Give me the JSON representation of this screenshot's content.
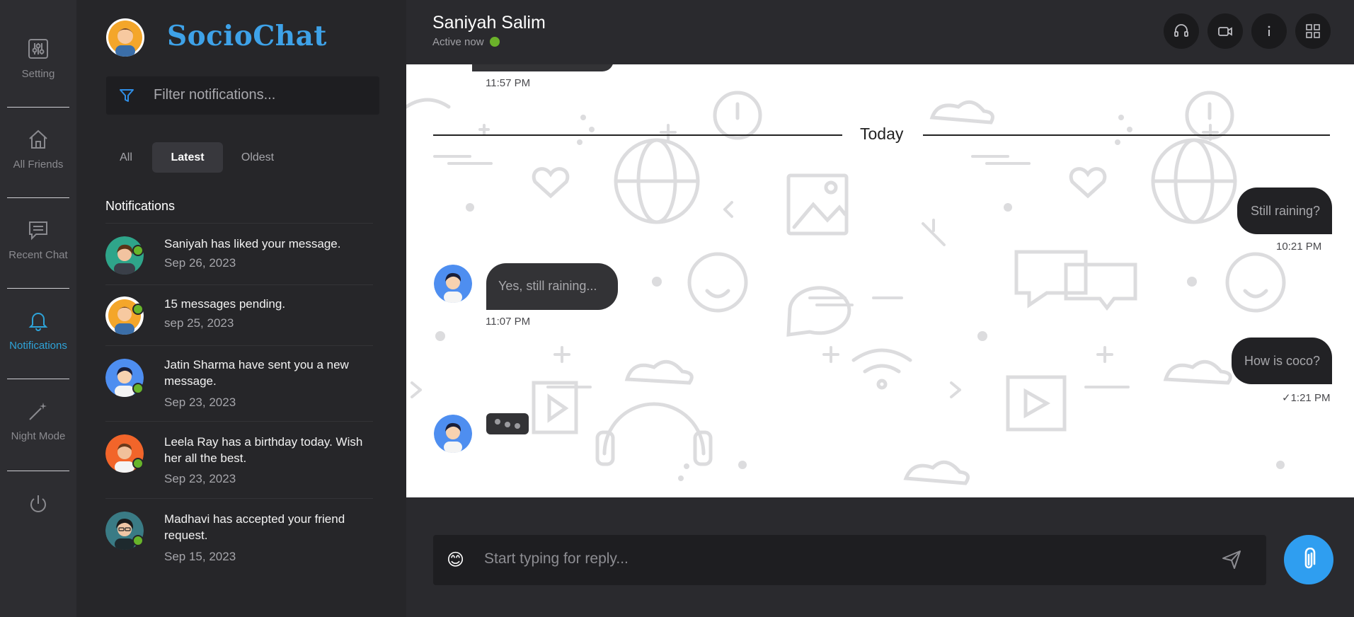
{
  "nav": {
    "items": [
      {
        "label": "Setting",
        "icon": "settings-sliders-icon",
        "active": false
      },
      {
        "label": "All Friends",
        "icon": "home-icon",
        "active": false
      },
      {
        "label": "Recent Chat",
        "icon": "chat-icon",
        "active": false
      },
      {
        "label": "Notifications",
        "icon": "bell-icon",
        "active": true
      },
      {
        "label": "Night Mode",
        "icon": "magic-wand-icon",
        "active": false
      }
    ],
    "power_icon": "power-icon"
  },
  "brand": {
    "name": "SocioChat"
  },
  "filter": {
    "placeholder": "Filter notifications..."
  },
  "tabs": [
    {
      "label": "All",
      "active": false
    },
    {
      "label": "Latest",
      "active": true
    },
    {
      "label": "Oldest",
      "active": false
    }
  ],
  "notifications": {
    "title": "Notifications",
    "items": [
      {
        "message": "Saniyah has liked your message.",
        "date": "Sep 26, 2023"
      },
      {
        "message": "15 messages pending.",
        "date": "sep 25, 2023"
      },
      {
        "message": "Jatin Sharma have sent you a new message.",
        "date": "Sep 23, 2023"
      },
      {
        "message": "Leela Ray has a birthday today. Wish her all the best.",
        "date": "Sep 23, 2023"
      },
      {
        "message": "Madhavi has accepted your friend request.",
        "date": "Sep 15, 2023"
      }
    ]
  },
  "chat": {
    "contact_name": "Saniyah Salim",
    "status": "Active now",
    "header_icons": [
      "headset-icon",
      "video-icon",
      "info-icon",
      "grid-icon"
    ],
    "earlier_time": "11:57 PM",
    "divider": "Today",
    "messages": [
      {
        "direction": "out",
        "text": "Still raining?",
        "time": "10:21 PM"
      },
      {
        "direction": "in",
        "text": "Yes, still raining...",
        "time": "11:07 PM"
      },
      {
        "direction": "out",
        "text": "How is coco?",
        "time": "1:21 PM"
      }
    ],
    "typing": "typing-indicator"
  },
  "composer": {
    "placeholder": "Start typing for reply...",
    "emoji": "😊"
  },
  "colors": {
    "accent": "#2ea3d8",
    "brand": "#3ea2e8",
    "online": "#67b52a",
    "attach_button": "#2f9ef0"
  }
}
